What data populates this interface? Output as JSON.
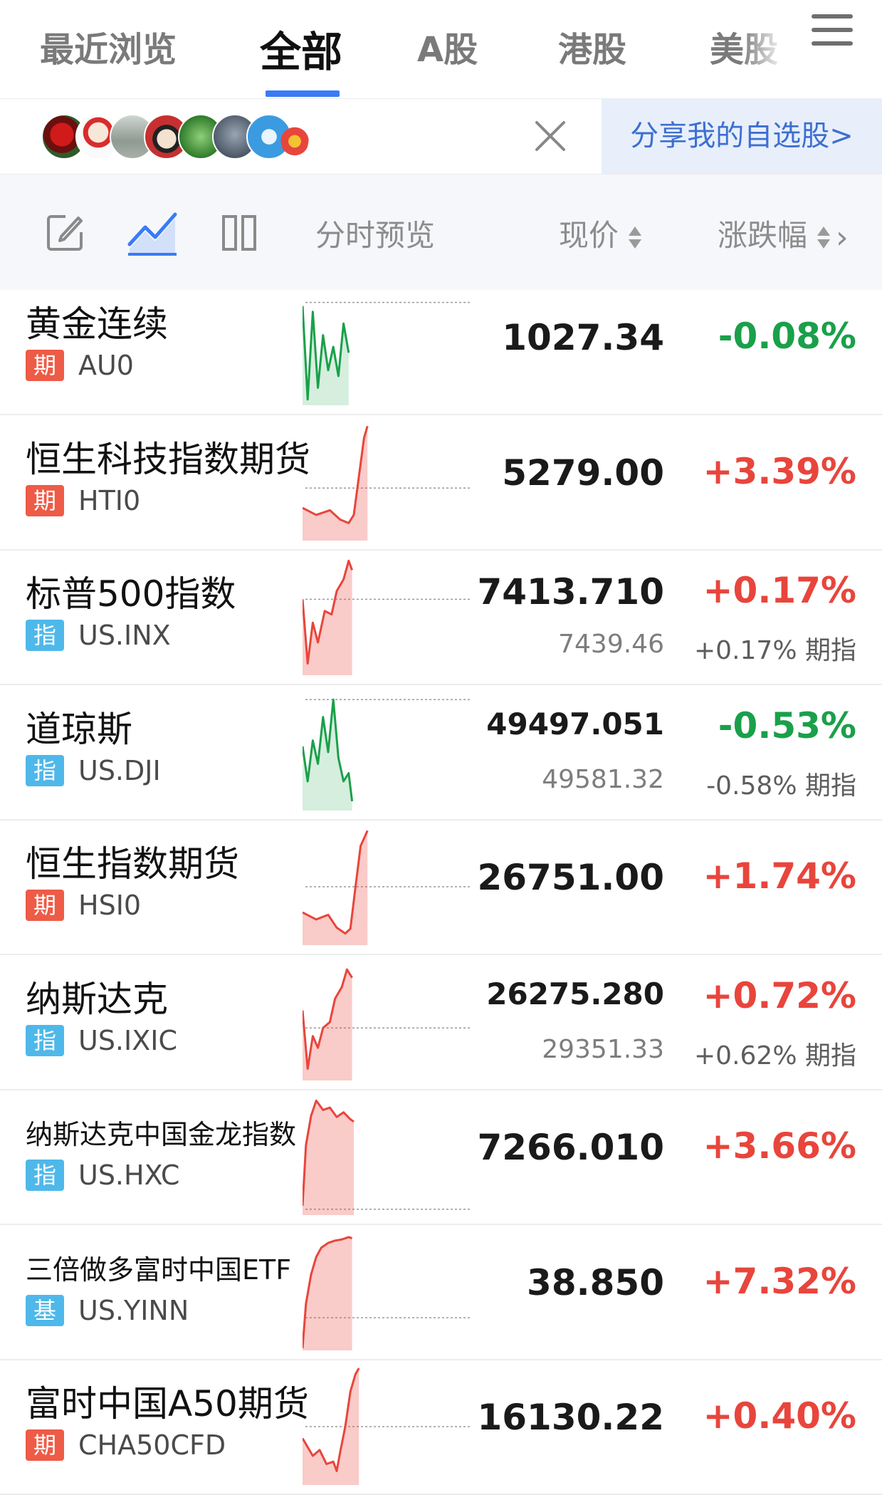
{
  "tabs": [
    {
      "label": "最近浏览",
      "active": false
    },
    {
      "label": "全部",
      "active": true
    },
    {
      "label": "A股",
      "active": false
    },
    {
      "label": "港股",
      "active": false
    },
    {
      "label": "美股",
      "active": false
    }
  ],
  "share": {
    "button_label": "分享我的自选股>"
  },
  "columns": {
    "preview_label": "分时预览",
    "price_label": "现价",
    "change_label": "涨跌幅"
  },
  "colors": {
    "up": "#e8453c",
    "down": "#1aa04a",
    "futures_badge": "#ee5b46",
    "index_badge": "#4fb8ea",
    "fund_badge": "#4fb8ea"
  },
  "rows": [
    {
      "name": "黄金连续",
      "badge": "期",
      "badge_type": "futures",
      "code": "AU0",
      "price": "1027.34",
      "change": "-0.08%",
      "dir": "down",
      "spark_icon": "sparkline-down",
      "name_size": "normal"
    },
    {
      "name": "恒生科技指数期货",
      "badge": "期",
      "badge_type": "futures",
      "code": "HTI0",
      "price": "5279.00",
      "change": "+3.39%",
      "dir": "up",
      "spark_icon": "sparkline-up",
      "name_size": "normal"
    },
    {
      "name": "标普500指数",
      "badge": "指",
      "badge_type": "index",
      "code": "US.INX",
      "price": "7413.710",
      "change": "+0.17%",
      "dir": "up",
      "sub_price": "7439.46",
      "sub_change": "+0.17% 期指",
      "spark_icon": "sparkline-up",
      "name_size": "normal"
    },
    {
      "name": "道琼斯",
      "badge": "指",
      "badge_type": "index",
      "code": "US.DJI",
      "price": "49497.051",
      "change": "-0.53%",
      "dir": "down",
      "sub_price": "49581.32",
      "sub_change": "-0.58% 期指",
      "spark_icon": "sparkline-down",
      "name_size": "normal"
    },
    {
      "name": "恒生指数期货",
      "badge": "期",
      "badge_type": "futures",
      "code": "HSI0",
      "price": "26751.00",
      "change": "+1.74%",
      "dir": "up",
      "spark_icon": "sparkline-up",
      "name_size": "normal"
    },
    {
      "name": "纳斯达克",
      "badge": "指",
      "badge_type": "index",
      "code": "US.IXIC",
      "price": "26275.280",
      "change": "+0.72%",
      "dir": "up",
      "sub_price": "29351.33",
      "sub_change": "+0.62% 期指",
      "spark_icon": "sparkline-up",
      "name_size": "normal"
    },
    {
      "name": "纳斯达克中国金龙指数",
      "badge": "指",
      "badge_type": "index",
      "code": "US.HXC",
      "price": "7266.010",
      "change": "+3.66%",
      "dir": "up",
      "spark_icon": "sparkline-up",
      "name_size": "small"
    },
    {
      "name": "三倍做多富时中国ETF",
      "badge": "基",
      "badge_type": "fund",
      "code": "US.YINN",
      "price": "38.850",
      "change": "+7.32%",
      "dir": "up",
      "spark_icon": "sparkline-up",
      "name_size": "small"
    },
    {
      "name": "富时中国A50期货",
      "badge": "期",
      "badge_type": "futures",
      "code": "CHA50CFD",
      "price": "16130.22",
      "change": "+0.40%",
      "dir": "up",
      "spark_icon": "sparkline-up",
      "name_size": "normal"
    }
  ]
}
